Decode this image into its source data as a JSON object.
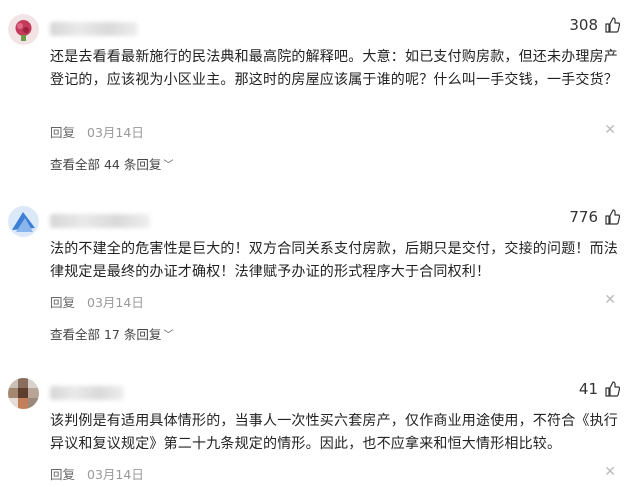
{
  "comments": [
    {
      "likes": "308",
      "text": "还是去看看最新施行的民法典和最高院的解释吧。大意：如已支付购房款，但还未办理房产登记的，应该视为小区业主。那这时的房屋应该属于谁的呢？什么叫一手交钱，一手交货？",
      "reply_label": "回复",
      "date": "03月14日",
      "view_replies": "查看全部 44 条回复"
    },
    {
      "likes": "776",
      "text": "法的不建全的危害性是巨大的！双方合同关系支付房款，后期只是交付，交接的问题！而法律规定是最终的办证才确权！法律赋予办证的形式程序大于合同权利！",
      "reply_label": "回复",
      "date": "03月14日",
      "view_replies": "查看全部 17 条回复"
    },
    {
      "likes": "41",
      "text": "该判例是有适用具体情形的，当事人一次性买六套房产，仅作商业用途使用，不符合《执行异议和复议规定》第二十九条规定的情形。因此，也不应拿来和恒大情形相比较。",
      "reply_label": "回复",
      "date": "03月14日"
    }
  ],
  "colors": {
    "text": "#222222",
    "meta": "#666666",
    "date": "#999999"
  },
  "icons": [
    "thumbs-up-icon",
    "close-icon",
    "chevron-down-icon"
  ]
}
